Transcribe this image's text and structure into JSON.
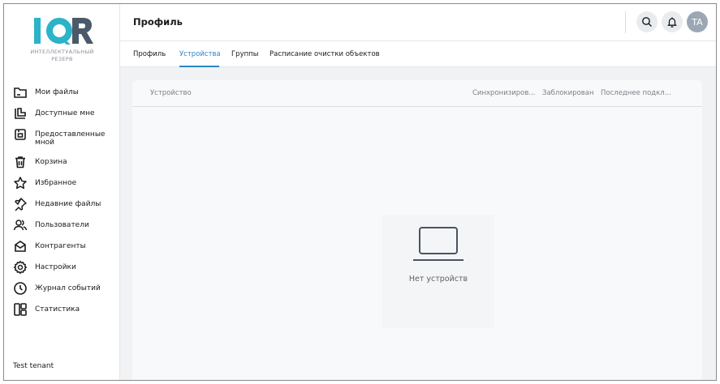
{
  "brand": {
    "logo_text": "IQR",
    "subtitle_line1": "ИНТЕЛЛЕКТУАЛЬНЫЙ",
    "subtitle_line2": "РЕЗЕРВ",
    "accent": "#2ab3c9",
    "dark": "#4a5a6a"
  },
  "sidebar": {
    "items": [
      {
        "label": "Мои файлы",
        "icon": "folder-icon"
      },
      {
        "label": "Доступные мне",
        "icon": "shared-folder-icon"
      },
      {
        "label": "Предоставленные мной",
        "icon": "shared-by-me-icon"
      },
      {
        "label": "Корзина",
        "icon": "trash-icon"
      },
      {
        "label": "Избранное",
        "icon": "star-icon"
      },
      {
        "label": "Недавние файлы",
        "icon": "pin-icon"
      },
      {
        "label": "Пользователи",
        "icon": "users-icon"
      },
      {
        "label": "Контрагенты",
        "icon": "contractors-icon"
      },
      {
        "label": "Настройки",
        "icon": "gear-icon"
      },
      {
        "label": "Журнал событий",
        "icon": "clock-icon"
      },
      {
        "label": "Статистика",
        "icon": "dashboard-icon"
      }
    ],
    "tenant": "Test tenant"
  },
  "header": {
    "title": "Профиль",
    "avatar_initials": "TA"
  },
  "tabs": [
    {
      "label": "Профиль",
      "active": false
    },
    {
      "label": "Устройства",
      "active": true
    },
    {
      "label": "Группы",
      "active": false
    },
    {
      "label": "Расписание очистки объектов",
      "active": false
    }
  ],
  "table": {
    "columns": [
      "Устройство",
      "Синхронизиров...",
      "Заблокирован",
      "Последнее подкл..."
    ],
    "empty_text": "Нет устройств"
  },
  "colors": {
    "tab_active": "#2b86c5",
    "avatar_bg": "#9ba7b4"
  }
}
